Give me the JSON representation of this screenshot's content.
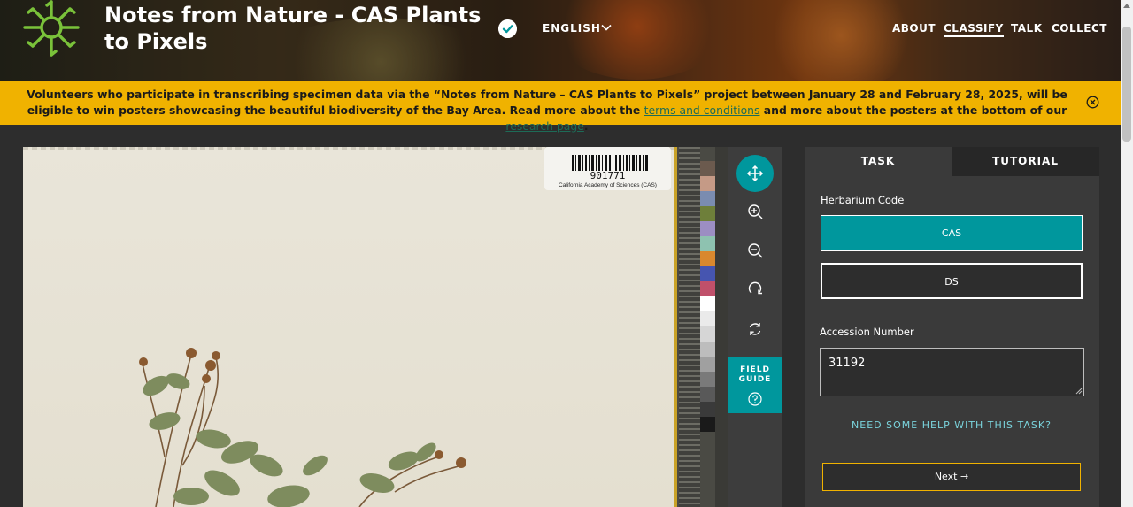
{
  "header": {
    "project_title": "Notes from Nature - CAS Plants to Pixels",
    "language": "ENGLISH",
    "nav": [
      {
        "label": "ABOUT",
        "active": false
      },
      {
        "label": "CLASSIFY",
        "active": true
      },
      {
        "label": "TALK",
        "active": false
      },
      {
        "label": "COLLECT",
        "active": false
      }
    ]
  },
  "banner": {
    "text_1": "Volunteers who participate in transcribing specimen data via the “Notes from Nature – CAS Plants to Pixels” project between January 28 and February 28, 2025, will be eligible to win posters showcasing the beautiful biodiversity of the Bay Area. Read more about the ",
    "link_1": "terms and conditions",
    "text_2": " and more about the posters at the bottom of our ",
    "link_2": "research page",
    "text_3": "."
  },
  "specimen": {
    "barcode_number": "901771",
    "institution": "California Academy of Sciences (CAS)",
    "color_swatches": [
      "#6b5a4e",
      "#c59a86",
      "#7a8cb0",
      "#6e7f3a",
      "#9c8ec2",
      "#8ec2b0",
      "#d9882e",
      "#4655b0",
      "#c0506a",
      "#ffffff",
      "#eaeaea",
      "#d6d6d6",
      "#bdbdbd",
      "#a0a0a0",
      "#7a7a7a",
      "#595959",
      "#3a3a3a",
      "#1a1a1a"
    ]
  },
  "tools": {
    "field_guide_line1": "FIELD",
    "field_guide_line2": "GUIDE"
  },
  "colors": {
    "accent": "#00979d",
    "banner": "#f0b200",
    "link": "#1d6b57"
  },
  "task": {
    "tabs": [
      "TASK",
      "TUTORIAL"
    ],
    "question_1": "Herbarium Code",
    "options": [
      "CAS",
      "DS"
    ],
    "selected_option": "CAS",
    "question_2": "Accession Number",
    "accession_value": "31192",
    "help_link": "NEED SOME HELP WITH THIS TASK?",
    "next_button": "Next →"
  }
}
